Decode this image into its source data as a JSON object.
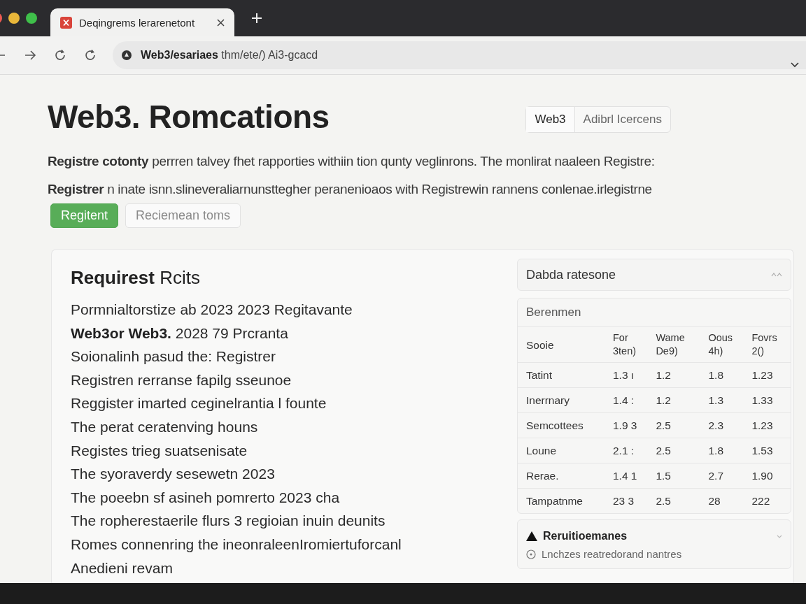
{
  "tabs": [
    {
      "title": "Deqingrems lerarenetont",
      "selected": true
    }
  ],
  "address_bar": {
    "url": "**Web3/esariaes** thm/ete/) Ai3-gcacd"
  },
  "header": {
    "title": "Web3. Romcations",
    "view_toggle": [
      {
        "label": "Web3",
        "selected": true
      },
      {
        "label": "Adibrl Icercens",
        "selected": false
      }
    ]
  },
  "intro_lines": [
    "**Registre cotonty** perrren talvey fhet rapporties withiin tion qunty veglinrons. The monlirat naaleen Registre:",
    "**Registrer** n inate isnn.slineveraliarnunsttegher peranenioaos with Registrewin rannens conlenae.irlegistrne"
  ],
  "actions": [
    {
      "label": "Regitent",
      "kind": "primary"
    },
    {
      "label": "Reciemean toms",
      "kind": "secondary"
    }
  ],
  "requirements": {
    "title": "**Requirest** Rcits",
    "items": [
      "Pormnialtorstize ab 2023 2023 Regitavante",
      "**Web3or Web3.** 2028 79 Prcranta",
      "Soionalinh pasud the: Registrer",
      "Registren rerranse fapilg sseunoe",
      "Reggister imarted ceginelrantia l founte",
      "The perat ceratenving houns",
      "Registes trieg suatsenisate",
      "The syoraverdy sesewetn 2023",
      "The poeebn sf asineh pomrerto 2023 cha",
      "The ropherestaerile flurs 3 regioian inuin deunits",
      "Romes connenring the ineonraleenIromiertuforcanl",
      "Anedieni revam"
    ]
  },
  "summary_panel": {
    "title": "Dabda ratesone"
  },
  "table": {
    "caption": "Berenmen",
    "columns": [
      "Sooie",
      "For 3ten)",
      "Wame De9)",
      "Oous 4h)",
      "Fovrs 2()"
    ],
    "rows": [
      [
        "Tatint",
        "1.3 ı",
        "1.2",
        "1.8",
        "1.23"
      ],
      [
        "Inerrnary",
        "1.4 :",
        "1.2",
        "1.3",
        "1.33"
      ],
      [
        "Semcottees",
        "1.9 3",
        "2.5",
        "2.3",
        "1.23"
      ],
      [
        "Loune",
        "2.1 :",
        "2.5",
        "1.8",
        "1.53"
      ],
      [
        "Rerae.",
        "1.4 1",
        "1.5",
        "2.7",
        "1.90"
      ],
      [
        "Tampatnme",
        "23 3",
        "2.5",
        "28",
        "222"
      ]
    ]
  },
  "alert": {
    "title": "Reruitioemanes",
    "note": "Lnchzes reatredorand nantres"
  }
}
